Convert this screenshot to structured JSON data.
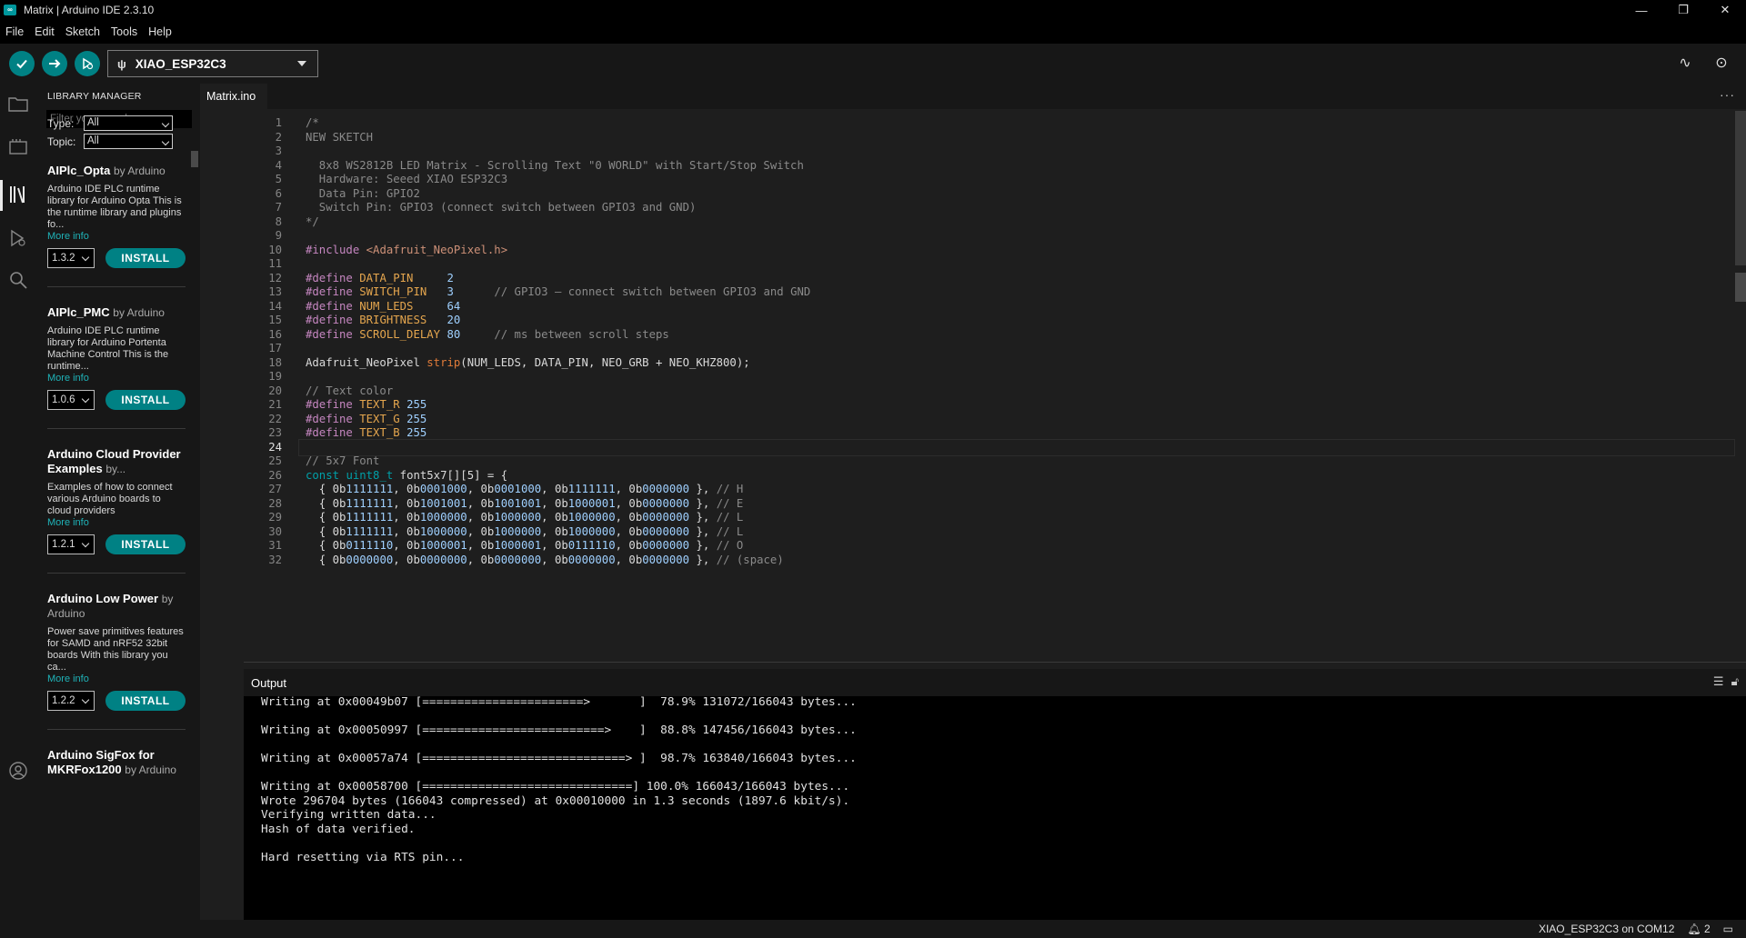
{
  "window": {
    "title": "Matrix | Arduino IDE 2.3.10",
    "app_icon_text": "∞",
    "minimize": "—",
    "maximize": "❐",
    "close": "✕"
  },
  "menu": [
    "File",
    "Edit",
    "Sketch",
    "Tools",
    "Help"
  ],
  "toolbar": {
    "verify_icon": "check-icon",
    "upload_icon": "arrow-right-icon",
    "debug_icon": "debug-icon",
    "board": "XIAO_ESP32C3",
    "usb_glyph": "ψ",
    "serial_plotter_glyph": "∿",
    "serial_monitor_glyph": "⊙"
  },
  "library_manager": {
    "title": "LIBRARY MANAGER",
    "search_placeholder": "Filter your search...",
    "type_label": "Type:",
    "type_value": "All",
    "topic_label": "Topic:",
    "topic_value": "All",
    "items": [
      {
        "name": "AIPlc_Opta",
        "author": "by Arduino",
        "description": "Arduino IDE PLC runtime library for Arduino Opta This is the runtime library and plugins fo...",
        "more": "More info",
        "version": "1.3.2",
        "install": "INSTALL"
      },
      {
        "name": "AIPlc_PMC",
        "author": "by Arduino",
        "description": "Arduino IDE PLC runtime library for Arduino Portenta Machine Control This is the runtime...",
        "more": "More info",
        "version": "1.0.6",
        "install": "INSTALL"
      },
      {
        "name": "Arduino Cloud Provider Examples",
        "author": "by...",
        "description": "Examples of how to connect various Arduino boards to cloud providers",
        "more": "More info",
        "version": "1.2.1",
        "install": "INSTALL"
      },
      {
        "name": "Arduino Low Power",
        "author": "by Arduino",
        "description": "Power save primitives features for SAMD and nRF52 32bit boards With this library you ca...",
        "more": "More info",
        "version": "1.2.2",
        "install": "INSTALL"
      },
      {
        "name": "Arduino SigFox for MKRFox1200",
        "author": "by Arduino",
        "description": "",
        "more": "",
        "version": "",
        "install": ""
      }
    ]
  },
  "editor": {
    "tab": "Matrix.ino",
    "more": "···",
    "current_line": 24,
    "lines": [
      {
        "n": "1",
        "t": [
          [
            "com",
            "/*"
          ]
        ]
      },
      {
        "n": "2",
        "t": [
          [
            "com",
            "NEW SKETCH"
          ]
        ]
      },
      {
        "n": "3",
        "t": []
      },
      {
        "n": "4",
        "t": [
          [
            "com",
            "  8x8 WS2812B LED Matrix - Scrolling Text \"0 WORLD\" with Start/Stop Switch"
          ]
        ]
      },
      {
        "n": "5",
        "t": [
          [
            "com",
            "  Hardware: Seeed XIAO ESP32C3"
          ]
        ]
      },
      {
        "n": "6",
        "t": [
          [
            "com",
            "  Data Pin: GPIO2"
          ]
        ]
      },
      {
        "n": "7",
        "t": [
          [
            "com",
            "  Switch Pin: GPIO3 (connect switch between GPIO3 and GND)"
          ]
        ]
      },
      {
        "n": "8",
        "t": [
          [
            "com",
            "*/"
          ]
        ]
      },
      {
        "n": "9",
        "t": []
      },
      {
        "n": "10",
        "t": [
          [
            "pre",
            "#include "
          ],
          [
            "str",
            "<Adafruit_NeoPixel.h>"
          ]
        ]
      },
      {
        "n": "11",
        "t": []
      },
      {
        "n": "12",
        "t": [
          [
            "pre",
            "#define "
          ],
          [
            "macro",
            "DATA_PIN"
          ],
          [
            "plain",
            "     "
          ],
          [
            "num",
            "2"
          ]
        ]
      },
      {
        "n": "13",
        "t": [
          [
            "pre",
            "#define "
          ],
          [
            "macro",
            "SWITCH_PIN"
          ],
          [
            "plain",
            "   "
          ],
          [
            "num",
            "3"
          ],
          [
            "plain",
            "      "
          ],
          [
            "com",
            "// GPIO3 — connect switch between GPIO3 and GND"
          ]
        ]
      },
      {
        "n": "14",
        "t": [
          [
            "pre",
            "#define "
          ],
          [
            "macro",
            "NUM_LEDS"
          ],
          [
            "plain",
            "     "
          ],
          [
            "num",
            "64"
          ]
        ]
      },
      {
        "n": "15",
        "t": [
          [
            "pre",
            "#define "
          ],
          [
            "macro",
            "BRIGHTNESS"
          ],
          [
            "plain",
            "   "
          ],
          [
            "num",
            "20"
          ]
        ]
      },
      {
        "n": "16",
        "t": [
          [
            "pre",
            "#define "
          ],
          [
            "macro",
            "SCROLL_DELAY"
          ],
          [
            "plain",
            " "
          ],
          [
            "num",
            "80"
          ],
          [
            "plain",
            "     "
          ],
          [
            "com",
            "// ms between scroll steps"
          ]
        ]
      },
      {
        "n": "17",
        "t": []
      },
      {
        "n": "18",
        "t": [
          [
            "plain",
            "Adafruit_NeoPixel "
          ],
          [
            "fn",
            "strip"
          ],
          [
            "plain",
            "(NUM_LEDS, DATA_PIN, NEO_GRB + NEO_KHZ800);"
          ]
        ]
      },
      {
        "n": "19",
        "t": []
      },
      {
        "n": "20",
        "t": [
          [
            "com",
            "// Text color"
          ]
        ]
      },
      {
        "n": "21",
        "t": [
          [
            "pre",
            "#define "
          ],
          [
            "macro",
            "TEXT_R"
          ],
          [
            "plain",
            " "
          ],
          [
            "num",
            "255"
          ]
        ]
      },
      {
        "n": "22",
        "t": [
          [
            "pre",
            "#define "
          ],
          [
            "macro",
            "TEXT_G"
          ],
          [
            "plain",
            " "
          ],
          [
            "num",
            "255"
          ]
        ]
      },
      {
        "n": "23",
        "t": [
          [
            "pre",
            "#define "
          ],
          [
            "macro",
            "TEXT_B"
          ],
          [
            "plain",
            " "
          ],
          [
            "num",
            "255"
          ]
        ]
      },
      {
        "n": "24",
        "t": []
      },
      {
        "n": "25",
        "t": [
          [
            "com",
            "// 5x7 Font"
          ]
        ]
      },
      {
        "n": "26",
        "t": [
          [
            "type",
            "const"
          ],
          [
            "plain",
            " "
          ],
          [
            "type",
            "uint8_t"
          ],
          [
            "plain",
            " font5x7[][5] = {"
          ]
        ]
      },
      {
        "n": "27",
        "t": [
          [
            "plain",
            "  { 0b"
          ],
          [
            "num",
            "1111111"
          ],
          [
            "plain",
            ", 0b"
          ],
          [
            "num",
            "0001000"
          ],
          [
            "plain",
            ", 0b"
          ],
          [
            "num",
            "0001000"
          ],
          [
            "plain",
            ", 0b"
          ],
          [
            "num",
            "1111111"
          ],
          [
            "plain",
            ", 0b"
          ],
          [
            "num",
            "0000000"
          ],
          [
            "plain",
            " }, "
          ],
          [
            "com",
            "// H"
          ]
        ]
      },
      {
        "n": "28",
        "t": [
          [
            "plain",
            "  { 0b"
          ],
          [
            "num",
            "1111111"
          ],
          [
            "plain",
            ", 0b"
          ],
          [
            "num",
            "1001001"
          ],
          [
            "plain",
            ", 0b"
          ],
          [
            "num",
            "1001001"
          ],
          [
            "plain",
            ", 0b"
          ],
          [
            "num",
            "1000001"
          ],
          [
            "plain",
            ", 0b"
          ],
          [
            "num",
            "0000000"
          ],
          [
            "plain",
            " }, "
          ],
          [
            "com",
            "// E"
          ]
        ]
      },
      {
        "n": "29",
        "t": [
          [
            "plain",
            "  { 0b"
          ],
          [
            "num",
            "1111111"
          ],
          [
            "plain",
            ", 0b"
          ],
          [
            "num",
            "1000000"
          ],
          [
            "plain",
            ", 0b"
          ],
          [
            "num",
            "1000000"
          ],
          [
            "plain",
            ", 0b"
          ],
          [
            "num",
            "1000000"
          ],
          [
            "plain",
            ", 0b"
          ],
          [
            "num",
            "0000000"
          ],
          [
            "plain",
            " }, "
          ],
          [
            "com",
            "// L"
          ]
        ]
      },
      {
        "n": "30",
        "t": [
          [
            "plain",
            "  { 0b"
          ],
          [
            "num",
            "1111111"
          ],
          [
            "plain",
            ", 0b"
          ],
          [
            "num",
            "1000000"
          ],
          [
            "plain",
            ", 0b"
          ],
          [
            "num",
            "1000000"
          ],
          [
            "plain",
            ", 0b"
          ],
          [
            "num",
            "1000000"
          ],
          [
            "plain",
            ", 0b"
          ],
          [
            "num",
            "0000000"
          ],
          [
            "plain",
            " }, "
          ],
          [
            "com",
            "// L"
          ]
        ]
      },
      {
        "n": "31",
        "t": [
          [
            "plain",
            "  { 0b"
          ],
          [
            "num",
            "0111110"
          ],
          [
            "plain",
            ", 0b"
          ],
          [
            "num",
            "1000001"
          ],
          [
            "plain",
            ", 0b"
          ],
          [
            "num",
            "1000001"
          ],
          [
            "plain",
            ", 0b"
          ],
          [
            "num",
            "0111110"
          ],
          [
            "plain",
            ", 0b"
          ],
          [
            "num",
            "0000000"
          ],
          [
            "plain",
            " }, "
          ],
          [
            "com",
            "// O"
          ]
        ]
      },
      {
        "n": "32",
        "t": [
          [
            "plain",
            "  { 0b"
          ],
          [
            "num",
            "0000000"
          ],
          [
            "plain",
            ", 0b"
          ],
          [
            "num",
            "0000000"
          ],
          [
            "plain",
            ", 0b"
          ],
          [
            "num",
            "0000000"
          ],
          [
            "plain",
            ", 0b"
          ],
          [
            "num",
            "0000000"
          ],
          [
            "plain",
            ", 0b"
          ],
          [
            "num",
            "0000000"
          ],
          [
            "plain",
            " }, "
          ],
          [
            "com",
            "// (space)"
          ]
        ]
      }
    ]
  },
  "output": {
    "title": "Output",
    "lines": [
      "Writing at 0x00049b07 [=======================>       ]  78.9% 131072/166043 bytes...",
      "",
      "Writing at 0x00050997 [==========================>    ]  88.8% 147456/166043 bytes...",
      "",
      "Writing at 0x00057a74 [=============================> ]  98.7% 163840/166043 bytes...",
      "",
      "Writing at 0x00058700 [==============================] 100.0% 166043/166043 bytes...",
      "Wrote 296704 bytes (166043 compressed) at 0x00010000 in 1.3 seconds (1897.6 kbit/s).",
      "Verifying written data...",
      "Hash of data verified.",
      "",
      "Hard resetting via RTS pin..."
    ]
  },
  "statusbar": {
    "board_port": "XIAO_ESP32C3 on COM12",
    "notifications": "2"
  }
}
